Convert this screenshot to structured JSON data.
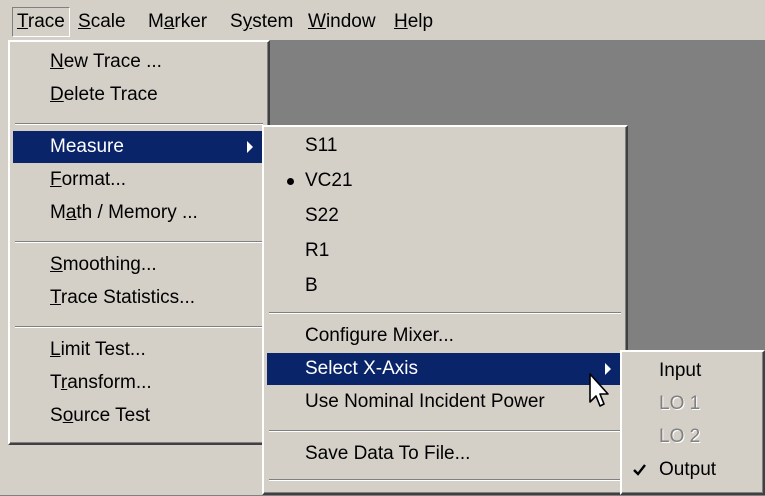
{
  "menubar": {
    "items": [
      {
        "label": "Trace",
        "underline": "T"
      },
      {
        "label": "Scale",
        "underline": "S"
      },
      {
        "label": "Marker",
        "underline": "a"
      },
      {
        "label": "System",
        "underline": "y"
      },
      {
        "label": "Window",
        "underline": "W"
      },
      {
        "label": "Help",
        "underline": "H"
      }
    ]
  },
  "trace_menu": {
    "items": [
      {
        "label": "New Trace ...",
        "underline": "N"
      },
      {
        "label": "Delete Trace",
        "underline": "D"
      },
      {
        "label": "Measure",
        "underline": "",
        "submenu": true,
        "highlighted": true
      },
      {
        "label": "Format...",
        "underline": "F"
      },
      {
        "label": "Math / Memory ...",
        "underline": "a"
      },
      {
        "label": "Smoothing...",
        "underline": "S"
      },
      {
        "label": "Trace Statistics...",
        "underline": "T"
      },
      {
        "label": "Limit Test...",
        "underline": "L"
      },
      {
        "label": "Transform...",
        "underline": "r"
      },
      {
        "label": "Source Test",
        "underline": "o"
      }
    ]
  },
  "measure_menu": {
    "items": [
      {
        "label": "S11"
      },
      {
        "label": "VC21",
        "selected": true
      },
      {
        "label": "S22"
      },
      {
        "label": "R1"
      },
      {
        "label": "B"
      },
      {
        "label": "Configure Mixer..."
      },
      {
        "label": "Select X-Axis",
        "submenu": true,
        "highlighted": true
      },
      {
        "label": "Use Nominal Incident Power"
      },
      {
        "label": "Save Data To File..."
      }
    ]
  },
  "xaxis_menu": {
    "items": [
      {
        "label": "Input",
        "enabled": true
      },
      {
        "label": "LO 1",
        "enabled": false
      },
      {
        "label": "LO 2",
        "enabled": false
      },
      {
        "label": "Output",
        "enabled": true,
        "checked": true
      }
    ]
  },
  "colors": {
    "menu_bg": "#d4d0c8",
    "highlight": "#0a246a",
    "workspace": "#808080"
  }
}
